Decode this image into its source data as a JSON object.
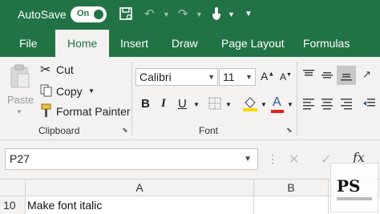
{
  "titlebar": {
    "autosave_label": "AutoSave",
    "toggle_state": "On",
    "icons": [
      "save-icon",
      "undo-icon",
      "redo-icon",
      "touch-mode-icon",
      "customize-toolbar-icon"
    ]
  },
  "tabs": [
    {
      "label": "File"
    },
    {
      "label": "Home",
      "active": true
    },
    {
      "label": "Insert"
    },
    {
      "label": "Draw"
    },
    {
      "label": "Page Layout"
    },
    {
      "label": "Formulas"
    }
  ],
  "ribbon": {
    "clipboard": {
      "paste_label": "Paste",
      "cut_label": "Cut",
      "copy_label": "Copy",
      "format_painter_label": "Format Painter",
      "group_label": "Clipboard"
    },
    "font": {
      "font_name": "Calibri",
      "font_size": "11",
      "bold_label": "B",
      "italic_label": "I",
      "underline_label": "U",
      "font_color_label": "A",
      "group_label": "Font"
    }
  },
  "formula_bar": {
    "name_box_value": "P27",
    "fx_label": "fx"
  },
  "grid": {
    "columns": [
      "A",
      "B"
    ],
    "row_number": "10",
    "cell_a_value": "Make font italic"
  },
  "watermark": {
    "text": "PS"
  },
  "colors": {
    "excel_green": "#217346",
    "ribbon_bg": "#f3f2f1",
    "highlight_yellow": "#ffd800",
    "font_red": "#e02020"
  }
}
